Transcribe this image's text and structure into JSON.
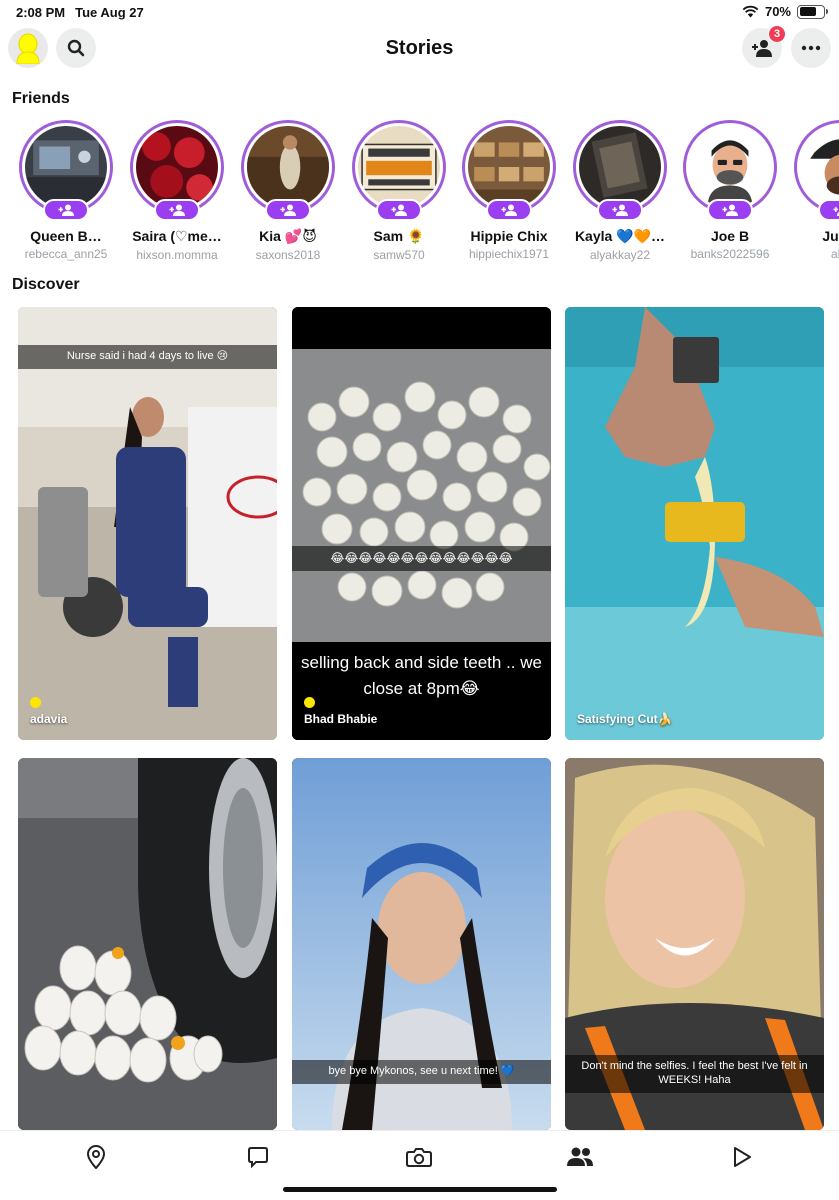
{
  "status_bar": {
    "time": "2:08 PM",
    "date": "Tue Aug 27",
    "battery": "70%",
    "battery_level": 0.7
  },
  "header": {
    "title": "Stories",
    "friend_requests_badge": "3"
  },
  "friends": {
    "title": "Friends",
    "items": [
      {
        "name": "Queen B…",
        "username": "rebecca_ann25"
      },
      {
        "name": "Saira (♡me…",
        "username": "hixson.momma"
      },
      {
        "name": "Kia 💕😈",
        "username": "saxons2018"
      },
      {
        "name": "Sam 🌻",
        "username": "samw570"
      },
      {
        "name": "Hippie Chix",
        "username": "hippiechix1971"
      },
      {
        "name": "Kayla 💙🧡…",
        "username": "alyakkay22"
      },
      {
        "name": "Joe B",
        "username": "banks2022596"
      },
      {
        "name": "Justb",
        "username": "ahh"
      }
    ]
  },
  "discover": {
    "title": "Discover",
    "cards": [
      {
        "caption": "Nurse said i had 4 days to live 😢",
        "label": "adavia"
      },
      {
        "caption": "😂😂😂😂😂😂😂😂😂😂😂😂😂",
        "big_caption": "selling back and side teeth .. we close at 8pm😂",
        "label": "Bhad Bhabie"
      },
      {
        "label": "Satisfying Cut🍌"
      },
      {},
      {
        "caption": "bye bye Mykonos, see u next time! 💙"
      },
      {
        "caption": "Don't mind the selfies. I feel the best I've felt in WEEKS! Haha"
      }
    ]
  },
  "colors": {
    "story_ring": "#a05dd9",
    "add_pill": "#9b3df0",
    "badge": "#f23c57",
    "bitmoji": "#fffc00"
  },
  "bottom_nav": {
    "items": [
      {
        "icon": "map-pin-icon"
      },
      {
        "icon": "chat-icon"
      },
      {
        "icon": "camera-icon"
      },
      {
        "icon": "stories-friends-icon"
      },
      {
        "icon": "spotlight-play-icon"
      }
    ]
  }
}
